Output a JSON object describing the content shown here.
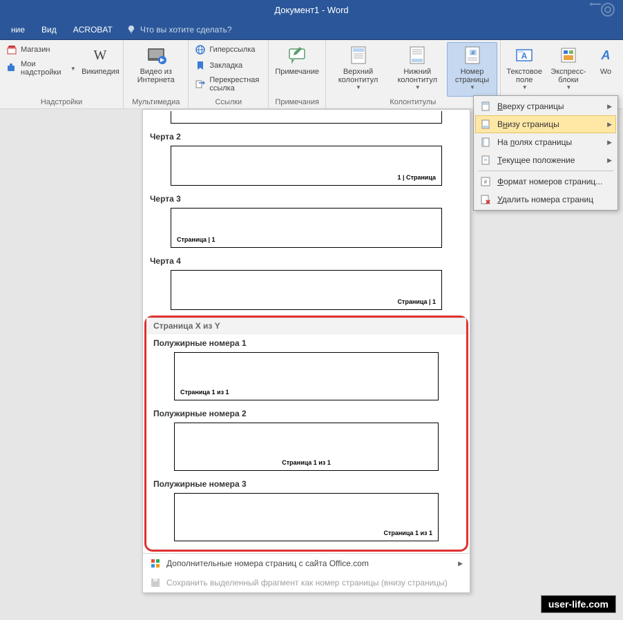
{
  "title": "Документ1 - Word",
  "tellme": "Что вы хотите сделать?",
  "tabs": [
    "ние",
    "Вид",
    "ACROBAT"
  ],
  "groups": {
    "addins": {
      "label": "Надстройки",
      "store": "Магазин",
      "myaddins": "Мои надстройки",
      "wikipedia": "Википедия"
    },
    "media": {
      "label": "Мультимедиа",
      "video": "Видео из Интернета"
    },
    "links": {
      "label": "Ссылки",
      "hyperlink": "Гиперссылка",
      "bookmark": "Закладка",
      "crossref": "Перекрестная ссылка"
    },
    "comments": {
      "label": "Примечания",
      "comment": "Примечание"
    },
    "headers": {
      "label": "Колонтитулы",
      "header": "Верхний колонтитул",
      "footer": "Нижний колонтитул",
      "pagenum": "Номер страницы"
    },
    "text": {
      "textbox": "Текстовое поле",
      "quickparts": "Экспресс-блоки",
      "wo": "Wo"
    }
  },
  "menu": {
    "top": "Вверху страницы",
    "bottom": "Внизу страницы",
    "margins": "На полях страницы",
    "current": "Текущее положение",
    "format": "Формат номеров страниц...",
    "remove": "Удалить номера страниц"
  },
  "gallery": {
    "items": [
      {
        "title": "Черта 2",
        "text": "1 | Страница",
        "pos": "right"
      },
      {
        "title": "Черта 3",
        "text": "Страница | 1",
        "pos": "left"
      },
      {
        "title": "Черта 4",
        "text": "Страница | 1",
        "pos": "right"
      }
    ],
    "section": "Страница X из Y",
    "bold_items": [
      {
        "title": "Полужирные номера 1",
        "text": "Страница 1 из 1",
        "pos": "left"
      },
      {
        "title": "Полужирные номера 2",
        "text": "Страница 1 из 1",
        "pos": "center"
      },
      {
        "title": "Полужирные номера 3",
        "text": "Страница 1 из 1",
        "pos": "right"
      }
    ],
    "more": "Дополнительные номера страниц с сайта Office.com",
    "save": "Сохранить выделенный фрагмент как номер страницы (внизу страницы)"
  },
  "watermark": "user-life.com"
}
